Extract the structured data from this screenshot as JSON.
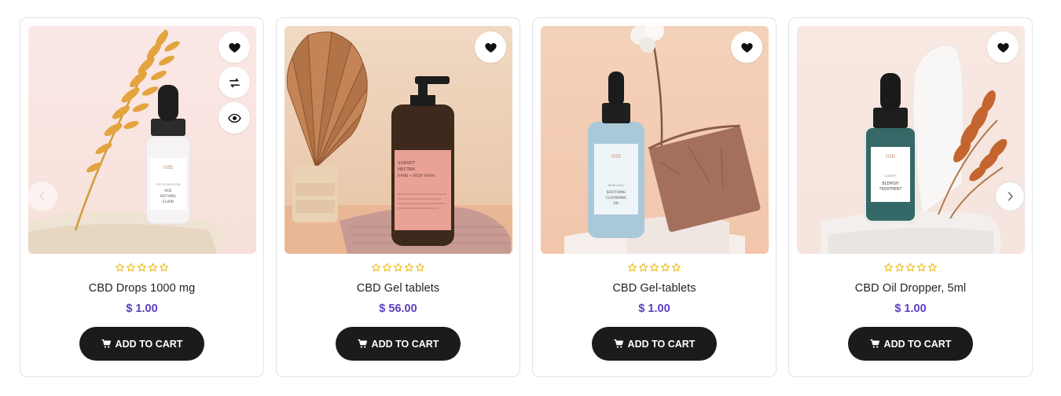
{
  "colors": {
    "price": "#5b3fc0",
    "button": "#1b1b1b",
    "stars": "#e8b600"
  },
  "products": [
    {
      "title": "CBD Drops 1000 mg",
      "price": "$ 1.00",
      "rating": 0,
      "cart_label": "ADD TO CART",
      "bottle_label": [
        "YOUTH INFUSION",
        "AGE",
        "DEFYING",
        "ELIXIR"
      ]
    },
    {
      "title": "CBD Gel tablets",
      "price": "$ 56.00",
      "rating": 0,
      "cart_label": "ADD TO CART",
      "bottle_label": [
        "SUNSET",
        "NECTAR",
        "HAND + BODY WASH"
      ]
    },
    {
      "title": "CBD Gel-tablets",
      "price": "$ 1.00",
      "rating": 0,
      "cart_label": "ADD TO CART",
      "bottle_label": [
        "BLUE AZUL",
        "SOOTHING",
        "CLEANSING",
        "OIL"
      ]
    },
    {
      "title": "CBD Oil Dropper, 5ml",
      "price": "$ 1.00",
      "rating": 0,
      "cart_label": "ADD TO CART",
      "bottle_label": [
        "CLARITY",
        "BLEMISH",
        "TREATMENT"
      ]
    }
  ],
  "icons": {
    "wishlist": "heart-icon",
    "compare": "compare-arrows-icon",
    "quick_view": "eye-icon",
    "cart": "cart-icon",
    "prev": "chevron-left-icon",
    "next": "chevron-right-icon",
    "star": "star-outline-icon"
  }
}
